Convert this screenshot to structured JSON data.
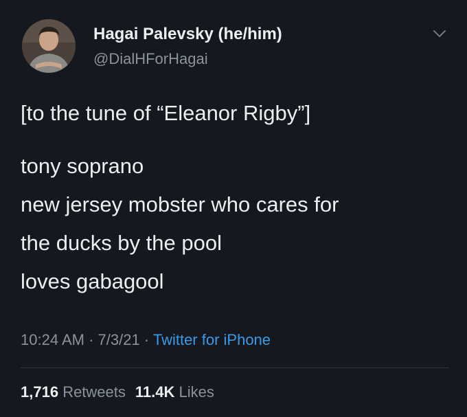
{
  "author": {
    "display_name": "Hagai Palevsky (he/him)",
    "handle": "@DialHForHagai",
    "avatar_icon": "profile-photo"
  },
  "menu_icon": "chevron-down-icon",
  "tweet": {
    "lead": "[to the tune of “Eleanor Rigby”]",
    "lines": [
      "tony soprano",
      "new jersey mobster who cares for",
      "the ducks by the pool",
      "loves gabagool"
    ]
  },
  "meta": {
    "time": "10:24 AM",
    "sep1": " · ",
    "date": "7/3/21",
    "sep2": " · ",
    "source": "Twitter for iPhone"
  },
  "stats": {
    "retweets_count": "1,716",
    "retweets_label": "Retweets",
    "likes_count": "11.4K",
    "likes_label": "Likes"
  },
  "colors": {
    "background": "#15181f",
    "text": "#eceef0",
    "muted": "#8b939d",
    "link": "#3b9ae8"
  }
}
